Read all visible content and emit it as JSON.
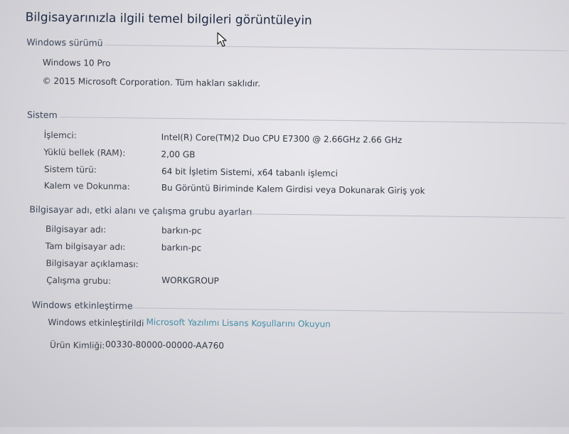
{
  "page_title": "Bilgisayarınızla ilgili temel bilgileri görüntüleyin",
  "windows_edition": {
    "heading": "Windows sürümü",
    "edition": "Windows 10 Pro",
    "copyright": "© 2015 Microsoft Corporation. Tüm hakları saklıdır."
  },
  "system": {
    "heading": "Sistem",
    "rows": [
      {
        "label": "İşlemci:",
        "value": "Intel(R) Core(TM)2 Duo CPU     E7300  @ 2.66GHz   2.66 GHz"
      },
      {
        "label": "Yüklü bellek (RAM):",
        "value": "2,00 GB"
      },
      {
        "label": "Sistem türü:",
        "value": "64 bit İşletim Sistemi, x64 tabanlı işlemci"
      },
      {
        "label": "Kalem ve Dokunma:",
        "value": "Bu Görüntü Biriminde Kalem Girdisi veya Dokunarak Giriş yok"
      }
    ]
  },
  "computer_name": {
    "heading": "Bilgisayar adı, etki alanı ve çalışma grubu ayarları",
    "rows": [
      {
        "label": "Bilgisayar adı:",
        "value": "barkın-pc"
      },
      {
        "label": "Tam bilgisayar adı:",
        "value": "barkın-pc"
      },
      {
        "label": "Bilgisayar açıklaması:",
        "value": ""
      },
      {
        "label": "Çalışma grubu:",
        "value": "WORKGROUP"
      }
    ]
  },
  "activation": {
    "heading": "Windows etkinleştirme",
    "status": "Windows etkinleştirildi",
    "license_link": "Microsoft Yazılımı Lisans Koşullarını Okuyun",
    "product_id_label": "Ürün Kimliği:",
    "product_id": "00330-80000-00000-AA760"
  },
  "icons": [
    "mouse-pointer-icon"
  ]
}
